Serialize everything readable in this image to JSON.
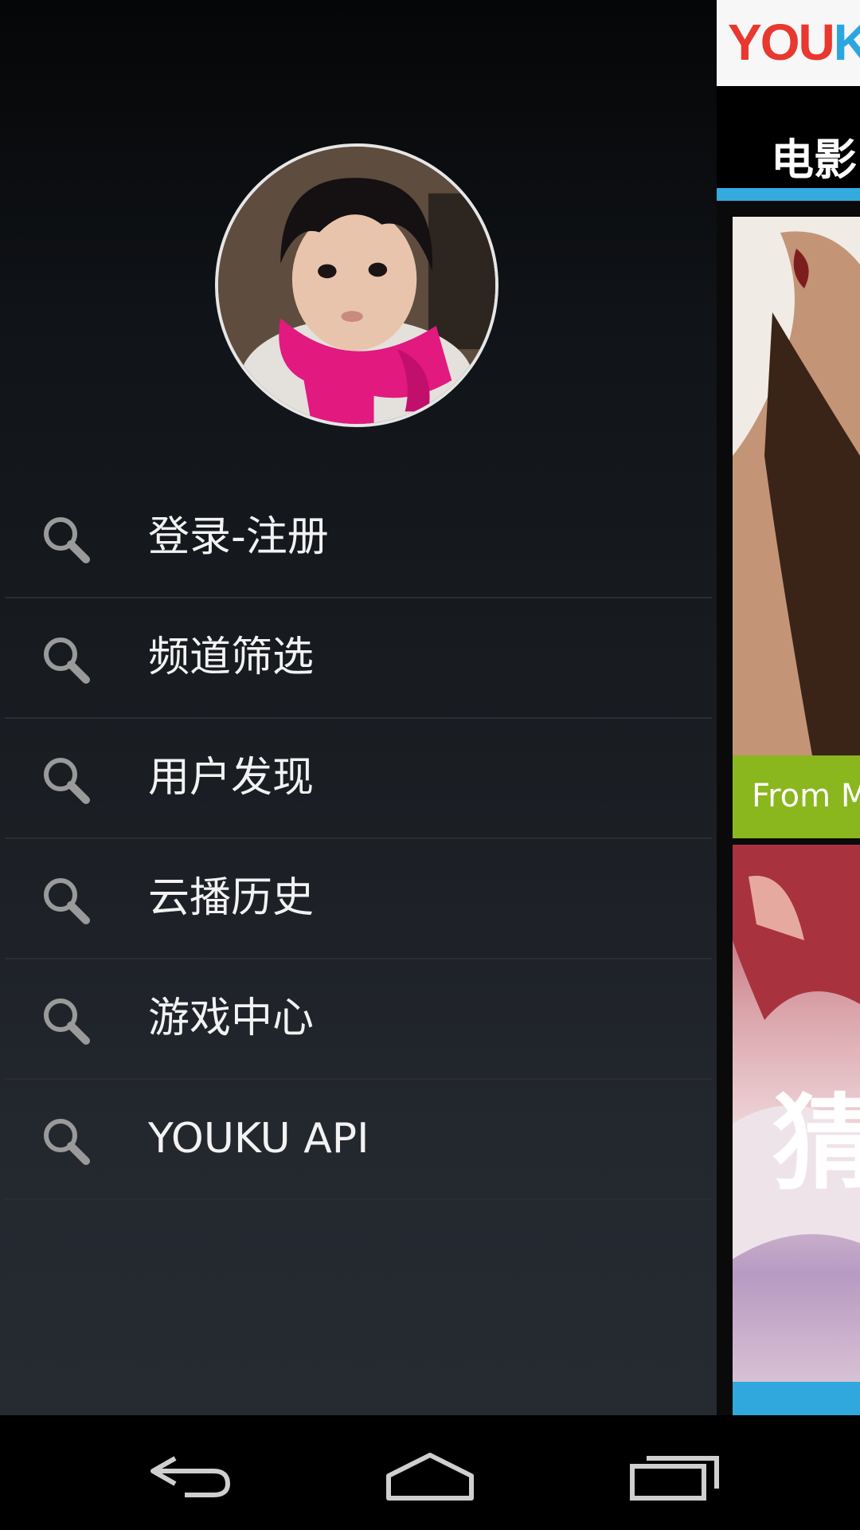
{
  "drawer": {
    "avatar_icon": "user-avatar-photo",
    "menu": [
      {
        "label": "登录-注册",
        "icon": "search-icon"
      },
      {
        "label": "频道筛选",
        "icon": "search-icon"
      },
      {
        "label": "用户发现",
        "icon": "search-icon"
      },
      {
        "label": "云播历史",
        "icon": "search-icon"
      },
      {
        "label": "游戏中心",
        "icon": "search-icon"
      },
      {
        "label": "YOUKU API",
        "icon": "search-icon"
      }
    ]
  },
  "content": {
    "logo": {
      "part1": "YOU",
      "part2": "KU"
    },
    "tab_label": "电影",
    "card_caption": "From M",
    "card2_glyph": "猜"
  },
  "colors": {
    "tab_accent": "#34aadf",
    "caption_green": "#8ab61e",
    "logo_red": "#e8382f",
    "logo_blue": "#2aa7e0"
  },
  "navbar": {
    "back_icon": "back-icon",
    "home_icon": "home-icon",
    "recents_icon": "recents-icon"
  }
}
